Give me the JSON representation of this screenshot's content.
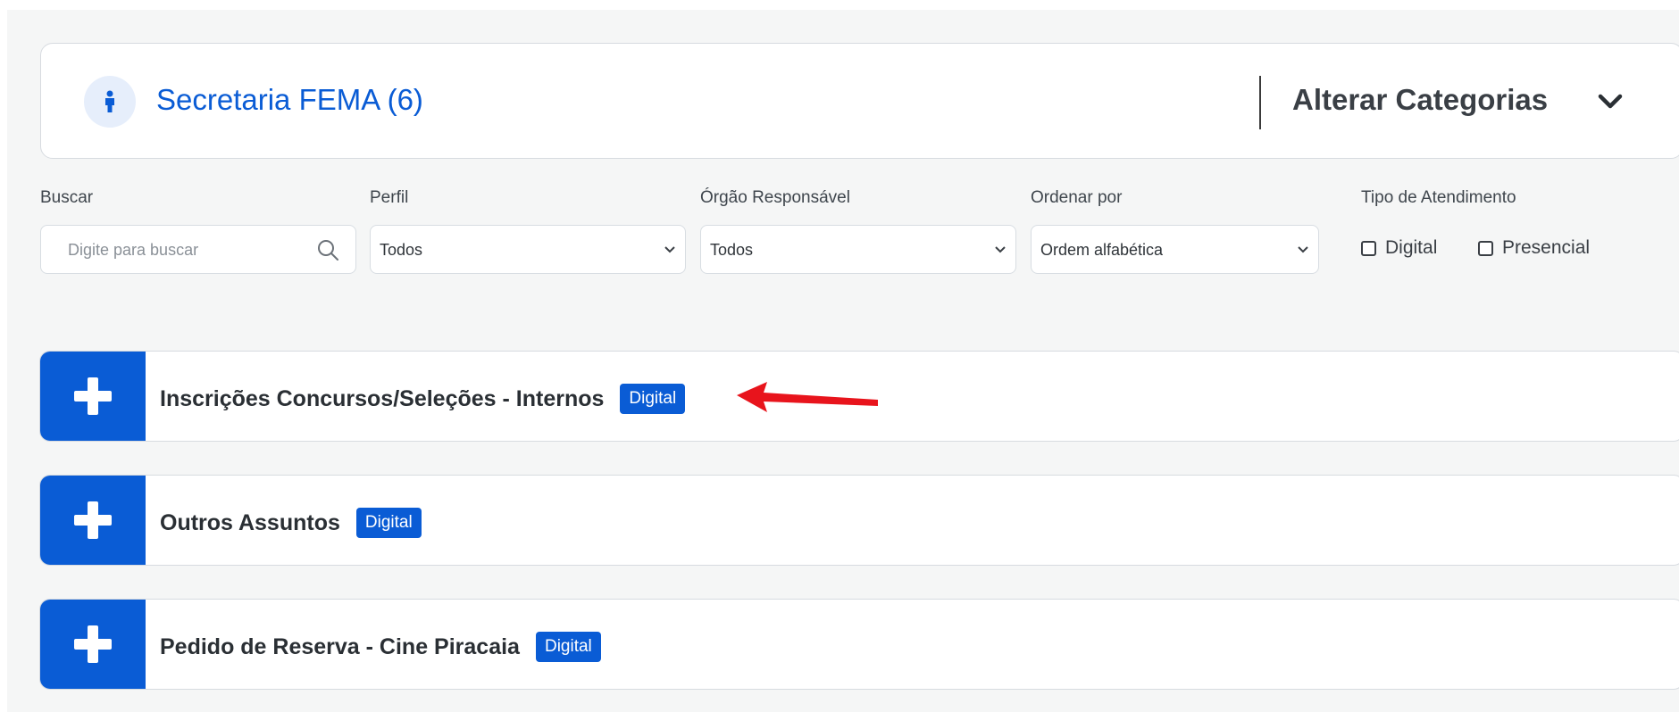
{
  "category": {
    "title": "Secretaria FEMA (6)",
    "change_label": "Alterar Categorias",
    "accent": "#0a5cd5",
    "icon": "person-icon"
  },
  "filters": {
    "search": {
      "label": "Buscar",
      "placeholder": "Digite para buscar"
    },
    "profile": {
      "label": "Perfil",
      "value": "Todos"
    },
    "agency": {
      "label": "Órgão Responsável",
      "value": "Todos"
    },
    "order": {
      "label": "Ordenar por",
      "value": "Ordem alfabética"
    },
    "service_type": {
      "label": "Tipo de Atendimento",
      "options": [
        "Digital",
        "Presencial"
      ]
    }
  },
  "services": [
    {
      "name": "Inscrições Concursos/Seleções - Internos",
      "badge": "Digital"
    },
    {
      "name": "Outros Assuntos",
      "badge": "Digital"
    },
    {
      "name": "Pedido de Reserva - Cine Piracaia",
      "badge": "Digital"
    }
  ],
  "colors": {
    "primary": "#0a5cd5",
    "annotation_arrow": "#e8141c"
  }
}
